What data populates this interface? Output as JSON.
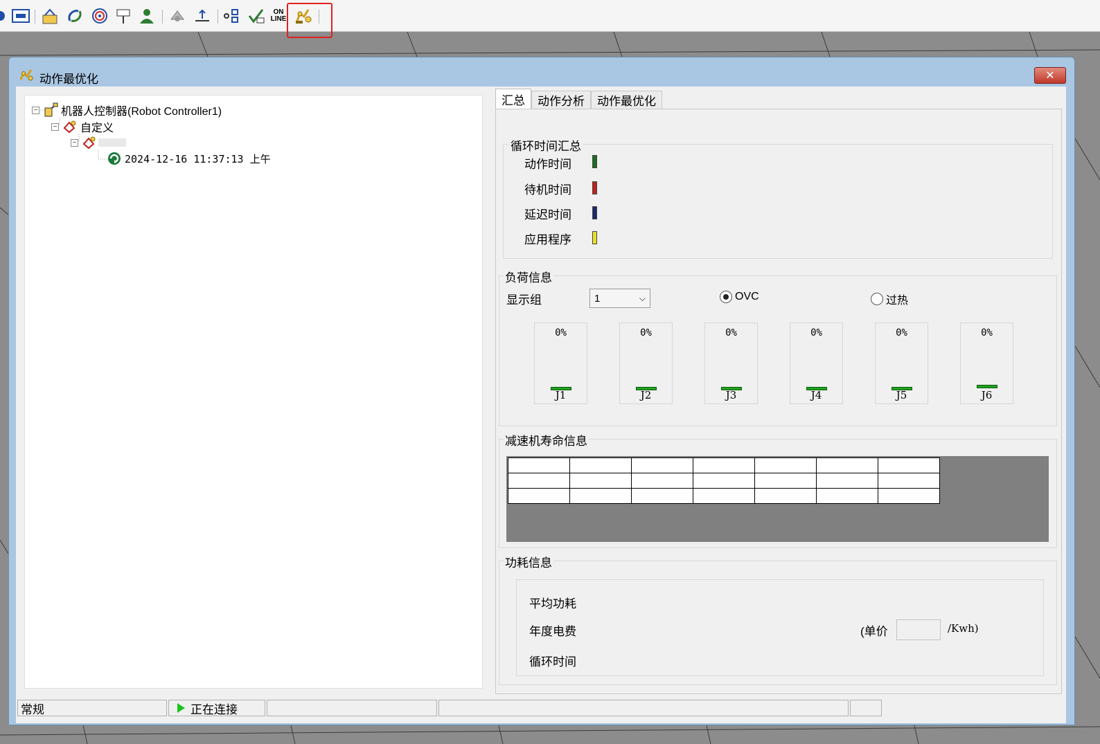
{
  "window": {
    "title": "动作最优化",
    "close_symbol": "✕"
  },
  "toolbar": {
    "online_label_top": "ON",
    "online_label_bottom": "LINE"
  },
  "tree": {
    "root": "机器人控制器(Robot Controller1)",
    "child": "自定义",
    "grandchild": "",
    "entry": "2024-12-16 11:37:13 上午"
  },
  "tabs": [
    {
      "label": "汇总"
    },
    {
      "label": "动作分析"
    },
    {
      "label": "动作最优化"
    }
  ],
  "cycle_summary": {
    "title": "循环时间汇总",
    "items": [
      {
        "label": "动作时间",
        "color": "#1e6b1e"
      },
      {
        "label": "待机时间",
        "color": "#c0211f"
      },
      {
        "label": "延迟时间",
        "color": "#1c2a6b"
      },
      {
        "label": "应用程序",
        "color": "#e8e02a"
      }
    ]
  },
  "load_info": {
    "title": "负荷信息",
    "display_group_label": "显示组",
    "display_group_value": "1",
    "radio_ovc": "OVC",
    "radio_overheat": "过热",
    "selected": "OVC",
    "joints": [
      {
        "label": "J1",
        "value": "0%"
      },
      {
        "label": "J2",
        "value": "0%"
      },
      {
        "label": "J3",
        "value": "0%"
      },
      {
        "label": "J4",
        "value": "0%"
      },
      {
        "label": "J5",
        "value": "0%"
      },
      {
        "label": "J6",
        "value": "0%"
      }
    ]
  },
  "reducer_life": {
    "title": "减速机寿命信息"
  },
  "power_info": {
    "title": "功耗信息",
    "avg_power": "平均功耗",
    "annual_cost": "年度电费",
    "cycle_time": "循环时间",
    "unit_price_prefix": "(单价",
    "unit_price_value": "",
    "unit_price_suffix": "/Kwh)"
  },
  "statusbar": {
    "mode": "常规",
    "connection": "正在连接"
  }
}
